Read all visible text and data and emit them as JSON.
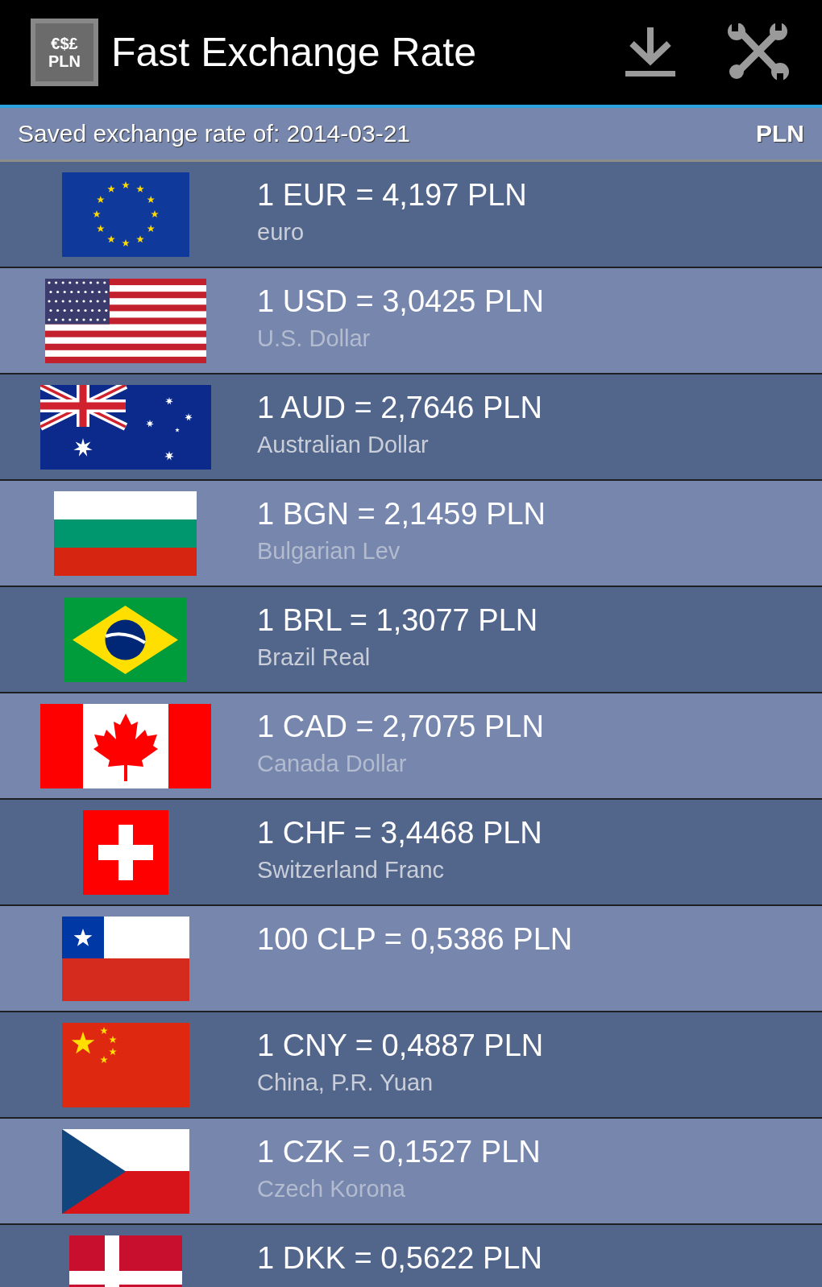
{
  "header": {
    "logo_lines": [
      "€$£",
      "PLN"
    ],
    "title": "Fast Exchange Rate"
  },
  "subheader": {
    "label": "Saved exchange rate of: 2014-03-21",
    "base": "PLN"
  },
  "rates": [
    {
      "kind": "eu",
      "rate": "1 EUR = 4,197 PLN",
      "name": "euro"
    },
    {
      "kind": "us",
      "rate": "1 USD = 3,0425 PLN",
      "name": "U.S. Dollar"
    },
    {
      "kind": "au",
      "rate": "1 AUD = 2,7646 PLN",
      "name": "Australian Dollar"
    },
    {
      "kind": "bg",
      "rate": "1 BGN = 2,1459 PLN",
      "name": "Bulgarian Lev"
    },
    {
      "kind": "br",
      "rate": "1 BRL = 1,3077 PLN",
      "name": "Brazil Real"
    },
    {
      "kind": "ca",
      "rate": "1 CAD = 2,7075 PLN",
      "name": "Canada Dollar"
    },
    {
      "kind": "ch",
      "rate": "1 CHF = 3,4468 PLN",
      "name": "Switzerland Franc"
    },
    {
      "kind": "cl",
      "rate": "100 CLP = 0,5386 PLN"
    },
    {
      "kind": "cn",
      "rate": "1 CNY = 0,4887 PLN",
      "name": "China, P.R. Yuan"
    },
    {
      "kind": "cz",
      "rate": "1 CZK = 0,1527 PLN",
      "name": "Czech Korona"
    },
    {
      "kind": "dk",
      "rate": "1 DKK = 0,5622 PLN"
    }
  ]
}
